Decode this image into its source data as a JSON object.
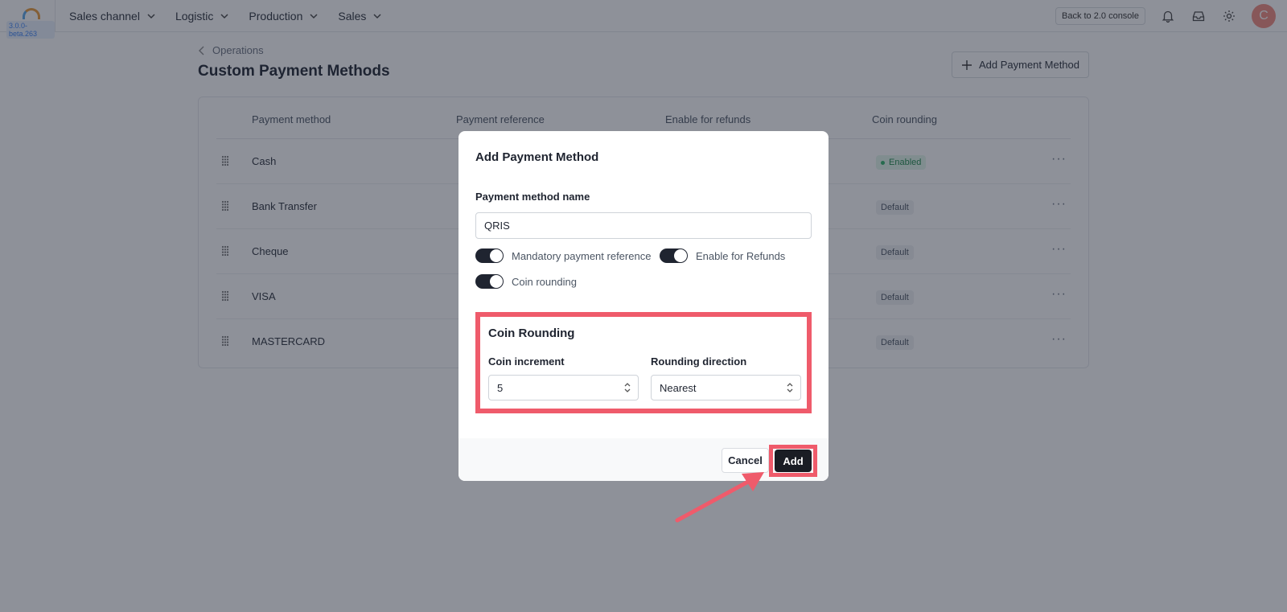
{
  "topbar": {
    "version": "3.0.0-beta.263",
    "nav": [
      {
        "label": "Sales channel"
      },
      {
        "label": "Logistic"
      },
      {
        "label": "Production"
      },
      {
        "label": "Sales"
      }
    ],
    "back_label": "Back to 2.0 console",
    "avatar_initial": "C"
  },
  "page": {
    "breadcrumb": "Operations",
    "title": "Custom Payment Methods",
    "add_button_label": "Add Payment Method"
  },
  "table": {
    "columns": [
      "Payment method",
      "Payment reference",
      "Enable for refunds",
      "Coin rounding"
    ],
    "rows": [
      {
        "name": "Cash",
        "coin_rounding": "Enabled"
      },
      {
        "name": "Bank Transfer",
        "coin_rounding": "Default"
      },
      {
        "name": "Cheque",
        "coin_rounding": "Default"
      },
      {
        "name": "VISA",
        "coin_rounding": "Default"
      },
      {
        "name": "MASTERCARD",
        "coin_rounding": "Default"
      }
    ]
  },
  "modal": {
    "title": "Add Payment Method",
    "name_label": "Payment method name",
    "name_value": "QRIS",
    "toggles": {
      "mandatory_ref": "Mandatory payment reference",
      "refunds": "Enable for Refunds",
      "coin_rounding": "Coin rounding"
    },
    "rounding": {
      "title": "Coin Rounding",
      "increment_label": "Coin increment",
      "increment_value": "5",
      "direction_label": "Rounding direction",
      "direction_value": "Nearest"
    },
    "cancel_label": "Cancel",
    "add_label": "Add"
  },
  "colors": {
    "highlight": "#ef5b6b",
    "primary": "#1a1d24"
  }
}
